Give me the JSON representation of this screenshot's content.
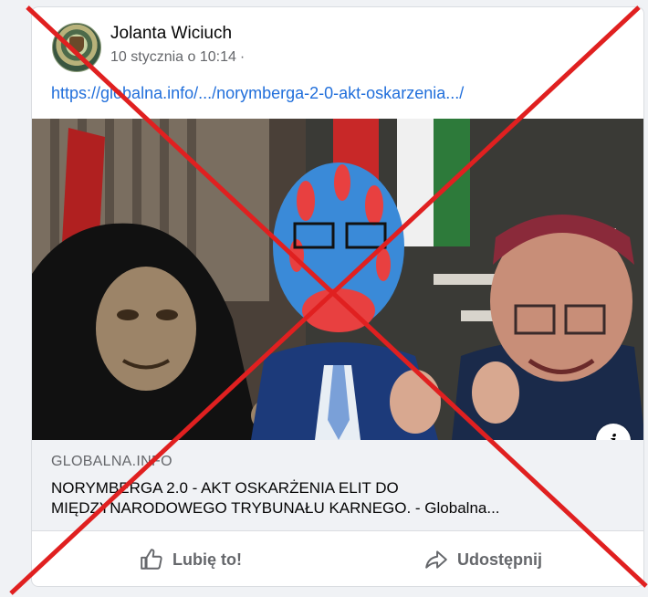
{
  "post": {
    "author": "Jolanta Wiciuch",
    "timestamp": "10 stycznia o 10:14",
    "separator": "·",
    "link_text": "https://globalna.info/.../norymberga-2-0-akt-oskarzenia.../"
  },
  "link_preview": {
    "domain": "GLOBALNA.INFO",
    "headline_line1": "NORYMBERGA 2.0 - AKT OSKARŻENIA ELIT DO",
    "headline_line2": "MIĘDZYNARODOWEGO TRYBUNAŁU KARNEGO. - Globalna...",
    "info_icon": "i"
  },
  "actions": {
    "like_label": "Lubię to!",
    "share_label": "Udostępnij"
  },
  "icons": {
    "like": "thumbs-up-icon",
    "share": "share-arrow-icon",
    "info": "info-icon",
    "overlay": "red-x-overlay"
  },
  "colors": {
    "link": "#216fdb",
    "muted": "#65676b",
    "overlay_red": "#e02020"
  }
}
